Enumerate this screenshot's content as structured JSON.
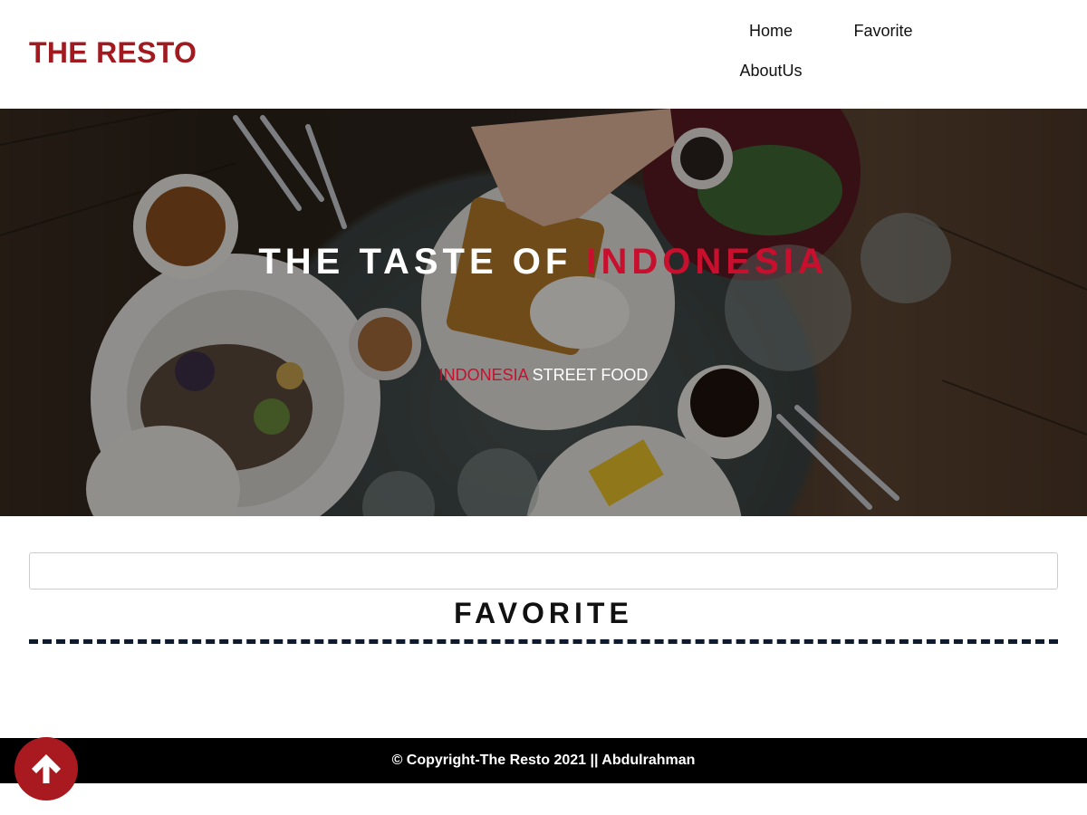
{
  "header": {
    "brand": "THE RESTO",
    "nav": [
      {
        "label": "Home"
      },
      {
        "label": "Favorite"
      },
      {
        "label": "AboutUs"
      }
    ]
  },
  "hero": {
    "title_prefix": "THE TASTE OF ",
    "title_accent": "INDONESIA",
    "subtitle_accent": "INDONESIA",
    "subtitle_rest": " STREET FOOD"
  },
  "main": {
    "search": {
      "value": "",
      "placeholder": ""
    },
    "section_title": "FAVORITE"
  },
  "footer": {
    "text": "© Copyright-The Resto 2021 || Abdulrahman"
  },
  "scroll_top": {
    "icon": "arrow-up-icon"
  },
  "colors": {
    "brand": "#a01a20",
    "accent": "#c8102e",
    "footer_bg": "#000000",
    "divider": "#0f1a2c"
  }
}
